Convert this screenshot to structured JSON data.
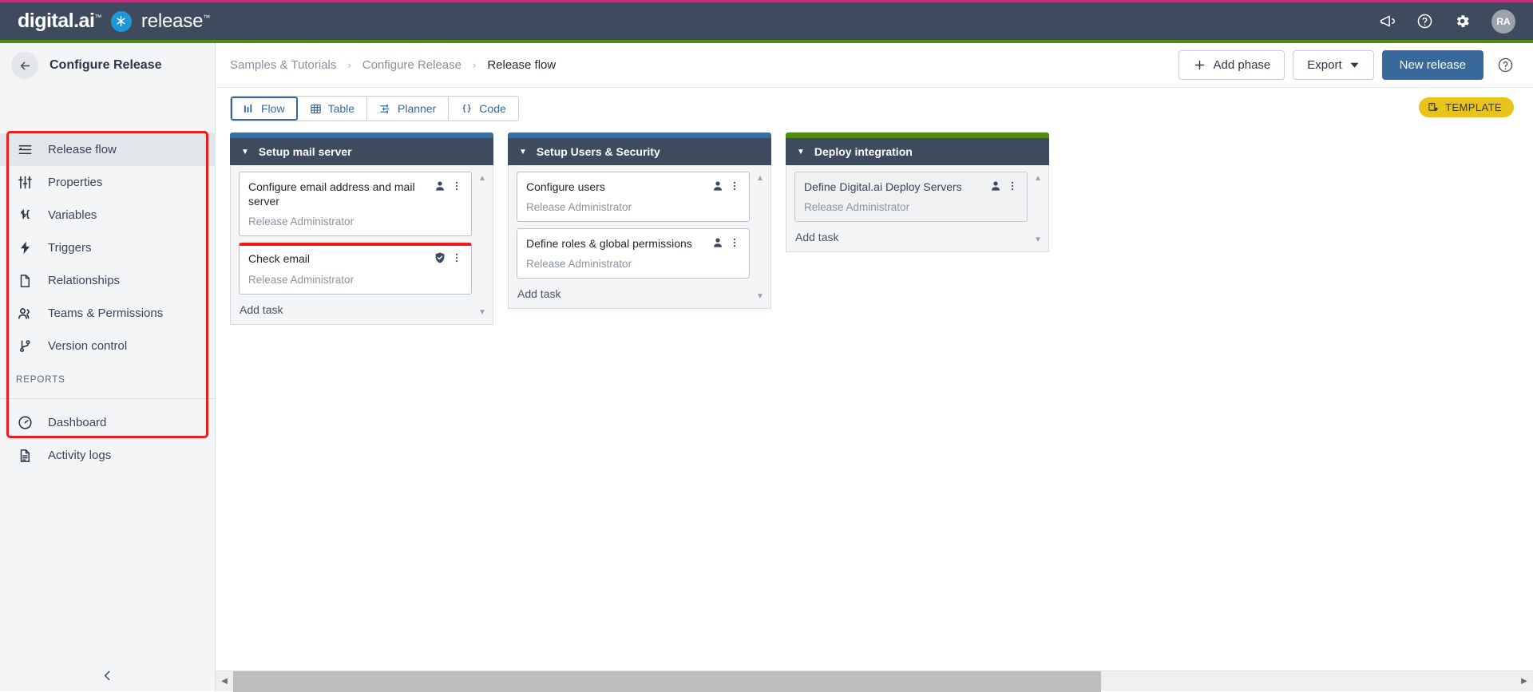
{
  "topbar": {
    "brand_primary": "digital.ai",
    "brand_tm": "™",
    "brand_product": "release",
    "brand_product_tm": "™",
    "icons": [
      {
        "name": "announcements-icon",
        "label": "Announcements"
      },
      {
        "name": "help-icon",
        "label": "Help"
      },
      {
        "name": "settings-gear-icon",
        "label": "Settings"
      }
    ],
    "avatar_initials": "RA",
    "accent_pink": "#c0317f",
    "bar_color": "#3e4b5e",
    "accent_green": "#4e8d12"
  },
  "sidebar": {
    "title": "Configure Release",
    "back_label": "Back",
    "items": [
      {
        "label": "Release flow",
        "icon": "flow-lines-icon",
        "active": true
      },
      {
        "label": "Properties",
        "icon": "sliders-icon",
        "active": false
      },
      {
        "label": "Variables",
        "icon": "dollar-brace-icon",
        "active": false
      },
      {
        "label": "Triggers",
        "icon": "lightning-icon",
        "active": false
      },
      {
        "label": "Relationships",
        "icon": "document-icon",
        "active": false
      },
      {
        "label": "Teams & Permissions",
        "icon": "people-icon",
        "active": false
      },
      {
        "label": "Version control",
        "icon": "git-branch-icon",
        "active": false
      }
    ],
    "group_label": "REPORTS",
    "report_items": [
      {
        "label": "Dashboard",
        "icon": "gauge-icon"
      },
      {
        "label": "Activity logs",
        "icon": "log-document-icon"
      }
    ],
    "collapse_label": "Collapse sidebar",
    "highlight_color": "#f01c1c"
  },
  "breadcrumb": {
    "items": [
      {
        "label": "Samples & Tutorials",
        "current": false
      },
      {
        "label": "Configure Release",
        "current": false
      },
      {
        "label": "Release flow",
        "current": true
      }
    ],
    "separator": "›"
  },
  "toolbar": {
    "add_phase_label": "Add phase",
    "export_label": "Export",
    "new_release_label": "New release",
    "help_label": "Help",
    "primary_color": "#39699b"
  },
  "viewtabs": {
    "tabs": [
      {
        "label": "Flow",
        "icon": "flow-bars-icon",
        "active": true
      },
      {
        "label": "Table",
        "icon": "table-grid-icon",
        "active": false
      },
      {
        "label": "Planner",
        "icon": "planner-lines-icon",
        "active": false
      },
      {
        "label": "Code",
        "icon": "curly-braces-icon",
        "active": false
      }
    ],
    "template_badge": "TEMPLATE",
    "template_icon": "template-edit-icon",
    "template_color": "#e8c31a"
  },
  "board": {
    "add_task_label": "Add task",
    "phases": [
      {
        "title": "Setup mail server",
        "accent": "#3b6fa0",
        "tasks": [
          {
            "title": "Configure email address and mail server",
            "owner": "Release Administrator",
            "icon": "person-icon",
            "menu_icon": "kebab-menu-icon",
            "flagged": false,
            "dim": false
          },
          {
            "title": "Check email",
            "owner": "Release Administrator",
            "icon": "shield-check-icon",
            "menu_icon": "kebab-menu-icon",
            "flagged": true,
            "dim": false
          }
        ]
      },
      {
        "title": "Setup Users & Security",
        "accent": "#3b6fa0",
        "tasks": [
          {
            "title": "Configure users",
            "owner": "Release Administrator",
            "icon": "person-icon",
            "menu_icon": "kebab-menu-icon",
            "flagged": false,
            "dim": false
          },
          {
            "title": "Define roles & global permissions",
            "owner": "Release Administrator",
            "icon": "person-icon",
            "menu_icon": "kebab-menu-icon",
            "flagged": false,
            "dim": false
          }
        ]
      },
      {
        "title": "Deploy integration",
        "accent": "#4e8d12",
        "tasks": [
          {
            "title": "Define Digital.ai Deploy Servers",
            "owner": "Release Administrator",
            "icon": "person-icon",
            "menu_icon": "kebab-menu-icon",
            "flagged": false,
            "dim": true
          }
        ]
      }
    ]
  },
  "scrollbar": {
    "left_arrow": "◀",
    "right_arrow": "▶",
    "up_arrow": "▲",
    "down_arrow": "▼"
  }
}
